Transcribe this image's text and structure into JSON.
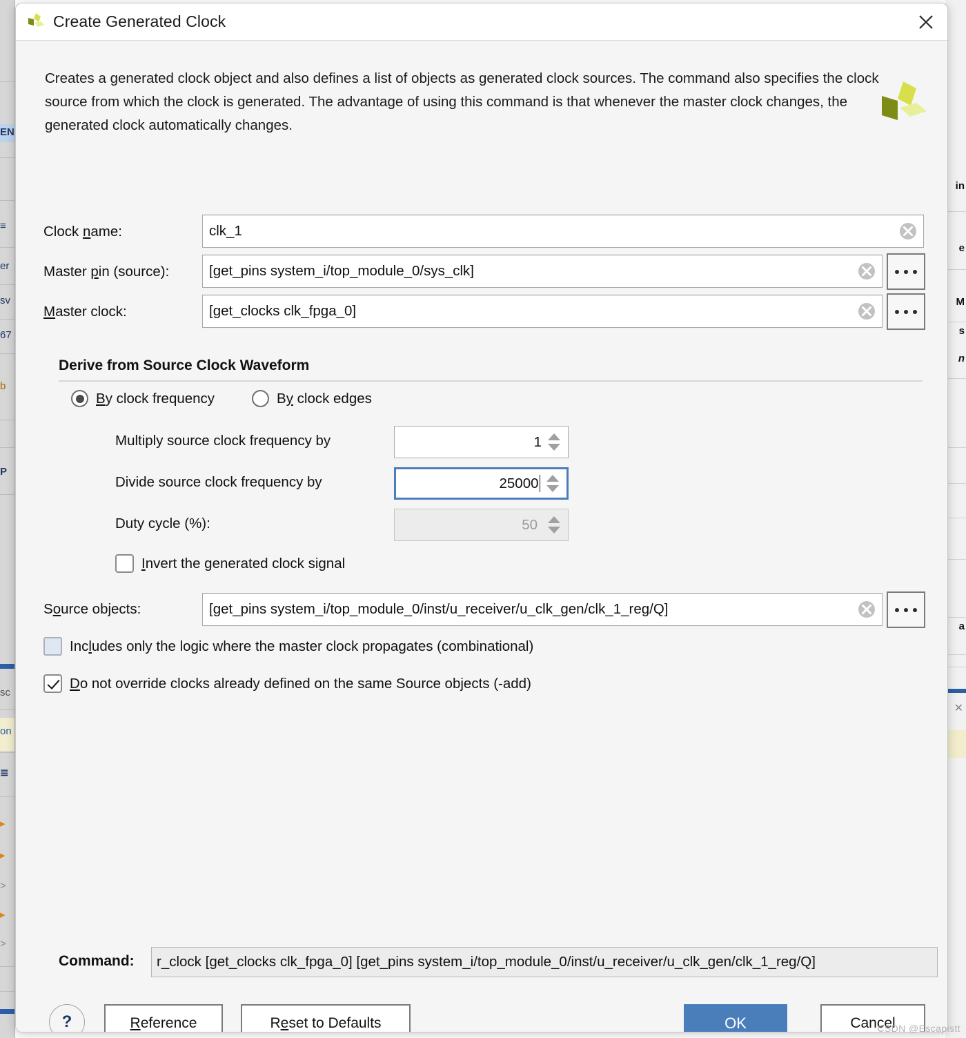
{
  "window": {
    "title": "Create Generated Clock",
    "logo_icon": "xilinx-logo-icon",
    "close_icon": "close-icon"
  },
  "description": "Creates a generated clock object and also defines a list of objects as generated clock sources. The command also specifies the clock source from which the clock is generated. The advantage of using this command is that whenever the master clock changes, the generated clock automatically changes.",
  "fields": {
    "clock_name": {
      "label_pre": "Clock ",
      "label_mnemonic": "n",
      "label_post": "ame:",
      "value": "clk_1",
      "clear_icon": "clear-circle-icon"
    },
    "master_pin": {
      "label_pre": "Master ",
      "label_mnemonic": "p",
      "label_post": "in (source):",
      "value": "[get_pins system_i/top_module_0/sys_clk]",
      "clear_icon": "clear-circle-icon",
      "browse_label": "..."
    },
    "master_clock": {
      "label_pre": "",
      "label_mnemonic": "M",
      "label_post": "aster clock:",
      "value": "[get_clocks clk_fpga_0]",
      "clear_icon": "clear-circle-icon",
      "browse_label": "..."
    },
    "source_objects": {
      "label_pre": "S",
      "label_mnemonic": "o",
      "label_post": "urce objects:",
      "value": "[get_pins system_i/top_module_0/inst/u_receiver/u_clk_gen/clk_1_reg/Q]",
      "clear_icon": "clear-circle-icon",
      "browse_label": "..."
    }
  },
  "group": {
    "title": "Derive from Source Clock Waveform",
    "radios": [
      {
        "pre": "",
        "mnemonic": "B",
        "post": "y clock frequency",
        "selected": true
      },
      {
        "pre": "B",
        "mnemonic": "y",
        "post": " clock edges",
        "selected": false
      }
    ],
    "spinners": [
      {
        "label": "Multiply source clock frequency by",
        "value": "1",
        "disabled": false,
        "focused": false
      },
      {
        "label": "Divide source clock frequency by",
        "value": "25000",
        "disabled": false,
        "focused": true
      },
      {
        "label": "Duty cycle (%):",
        "value": "50",
        "disabled": true,
        "focused": false
      }
    ],
    "invert_checkbox": {
      "pre": "",
      "mnemonic": "I",
      "post": "nvert the generated clock signal",
      "checked": false
    }
  },
  "checkboxes": [
    {
      "pre": "Inc",
      "mnemonic": "l",
      "post": "udes only the logic where the master clock propagates (combinational)",
      "checked": false,
      "style": "light"
    },
    {
      "pre": "",
      "mnemonic": "D",
      "post": "o not override clocks already defined on the same Source objects (-add)",
      "checked": true,
      "style": "normal"
    }
  ],
  "command": {
    "label": "Command:",
    "value": "r_clock [get_clocks clk_fpga_0] [get_pins system_i/top_module_0/inst/u_receiver/u_clk_gen/clk_1_reg/Q]"
  },
  "footer": {
    "help_label": "?",
    "reference": {
      "pre": "",
      "mnemonic": "R",
      "post": "eference"
    },
    "reset": {
      "pre": "R",
      "mnemonic": "e",
      "post": "set to Defaults"
    },
    "ok_label": "OK",
    "cancel_label": "Cancel"
  },
  "watermark": "CSDN @Escapistt",
  "colors": {
    "accent_blue": "#4a7ebb",
    "dialog_bg": "#f5f5f5",
    "logo_dark": "#7d8c16",
    "logo_mid": "#d7e04a",
    "logo_light": "#e8ef9a"
  },
  "backdrop": {
    "left_items": [
      "EN",
      "≡",
      "er",
      "sv",
      "67",
      "b",
      "P",
      "sc",
      "on",
      "≣",
      "▸",
      "▸",
      ">",
      "▸",
      ">"
    ],
    "right_items": [
      "in",
      "e",
      "M",
      "s",
      "n",
      "a"
    ]
  }
}
